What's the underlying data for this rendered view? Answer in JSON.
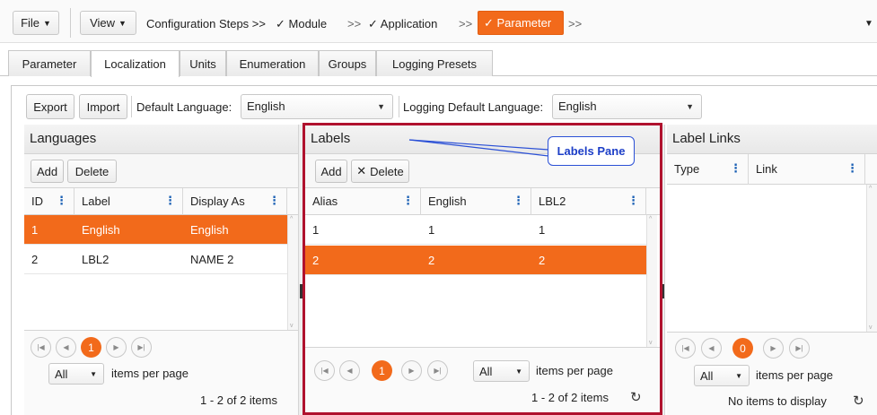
{
  "toolbar": {
    "file_label": "File",
    "view_label": "View",
    "steps_label": "Configuration Steps >>",
    "step_module": "✓ Module",
    "sep1": ">>",
    "step_application": "✓ Application",
    "sep2": ">>",
    "step_parameter": "✓ Parameter",
    "sep3": ">>"
  },
  "tabs": [
    {
      "label": "Parameter"
    },
    {
      "label": "Localization",
      "active": true
    },
    {
      "label": "Units"
    },
    {
      "label": "Enumeration"
    },
    {
      "label": "Groups"
    },
    {
      "label": "Logging Presets"
    }
  ],
  "lang_bar": {
    "export_label": "Export",
    "import_label": "Import",
    "default_language_label": "Default Language:",
    "default_language_value": "English",
    "logging_default_language_label": "Logging Default Language:",
    "logging_default_language_value": "English"
  },
  "languages": {
    "title": "Languages",
    "add_label": "Add",
    "delete_label": "Delete",
    "columns": [
      "ID",
      "Label",
      "Display As"
    ],
    "rows": [
      {
        "id": "1",
        "label": "English",
        "display_as": "English",
        "selected": true
      },
      {
        "id": "2",
        "label": "LBL2",
        "display_as": "NAME 2",
        "selected": false
      }
    ],
    "page": "1",
    "page_size": "All",
    "items_per_page": "items per page",
    "range_text": "1 - 2 of 2 items"
  },
  "labels": {
    "title": "Labels",
    "add_label": "Add",
    "delete_label": "Delete",
    "columns": [
      "Alias",
      "English",
      "LBL2"
    ],
    "rows": [
      {
        "alias": "1",
        "english": "1",
        "lbl2": "1",
        "selected": false
      },
      {
        "alias": "2",
        "english": "2",
        "lbl2": "2",
        "selected": true
      }
    ],
    "page": "1",
    "page_size": "All",
    "items_per_page": "items per page",
    "range_text": "1 - 2 of 2 items"
  },
  "label_links": {
    "title": "Label Links",
    "columns": [
      "Type",
      "Link"
    ],
    "page": "0",
    "page_size": "All",
    "items_per_page": "items per page",
    "range_text": "No items to display"
  },
  "callout": {
    "text": "Labels Pane"
  },
  "colors": {
    "accent": "#f26a1b",
    "highlight_border": "#b0122e",
    "callout": "#2b50d6"
  }
}
